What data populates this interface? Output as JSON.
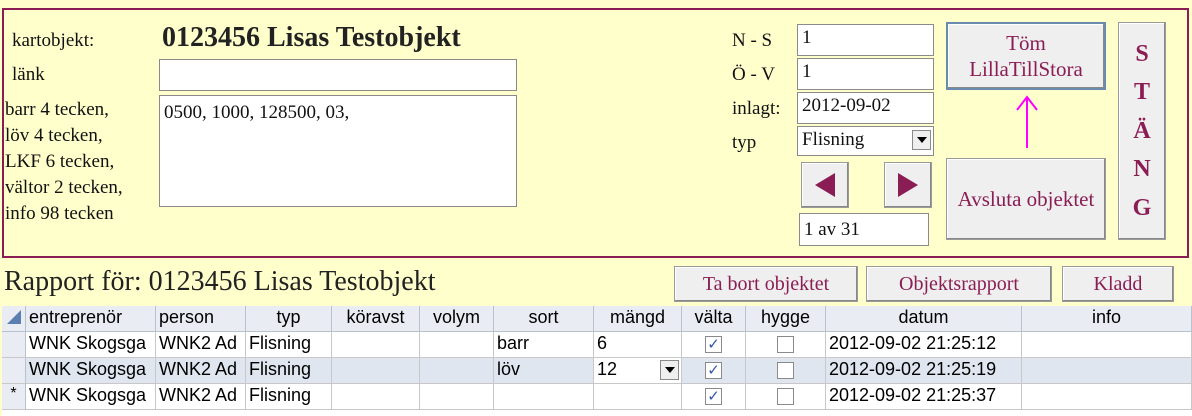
{
  "form": {
    "kartobjekt_label": "kartobjekt:",
    "kartobjekt_value": "0123456 Lisas Testobjekt",
    "lank_label": "länk",
    "lank_value": "",
    "info_labels": [
      "barr 4 tecken,",
      "löv 4 tecken,",
      "LKF 6 tecken,",
      "vältor 2 tecken,",
      "info 98 tecken"
    ],
    "codes_value": "0500, 1000, 128500, 03,",
    "ns_label": "N - S",
    "ns_value": "1",
    "ov_label": "Ö - V",
    "ov_value": "1",
    "inlagt_label": "inlagt:",
    "inlagt_value": "2012-09-02",
    "typ_label": "typ",
    "typ_value": "Flisning",
    "record_counter": "1 av 31",
    "tom_button": "Töm LillaTillStora",
    "avsluta_button": "Avsluta objektet",
    "stang_letters": [
      "S",
      "T",
      "Ä",
      "N",
      "G"
    ],
    "accent_color": "#8b1d55",
    "arrow_color": "#ff00ff"
  },
  "report": {
    "title": "Rapport för: 0123456 Lisas Testobjekt",
    "buttons": [
      "Ta bort objektet",
      "Objektsrapport",
      "Kladd"
    ]
  },
  "grid": {
    "columns": [
      "entreprenör",
      "person",
      "typ",
      "köravst",
      "volym",
      "sort",
      "mängd",
      "välta",
      "hygge",
      "datum",
      "info"
    ],
    "rows": [
      {
        "entreprenor": "WNK Skogsga",
        "person": "WNK2 Ad",
        "typ": "Flisning",
        "koravst": "",
        "volym": "",
        "sort": "barr",
        "mangd": "6",
        "valta": true,
        "hygge": false,
        "datum": "2012-09-02 21:25:12",
        "info": ""
      },
      {
        "entreprenor": "WNK Skogsga",
        "person": "WNK2 Ad",
        "typ": "Flisning",
        "koravst": "",
        "volym": "",
        "sort": "löv",
        "mangd": "12",
        "valta": true,
        "hygge": false,
        "datum": "2012-09-02 21:25:19",
        "info": ""
      },
      {
        "entreprenor": "WNK Skogsga",
        "person": "WNK2 Ad",
        "typ": "Flisning",
        "koravst": "",
        "volym": "",
        "sort": "",
        "mangd": "",
        "valta": true,
        "hygge": false,
        "datum": "2012-09-02 21:25:37",
        "info": ""
      }
    ],
    "new_row_marker": "*",
    "check_mark": "✓"
  }
}
